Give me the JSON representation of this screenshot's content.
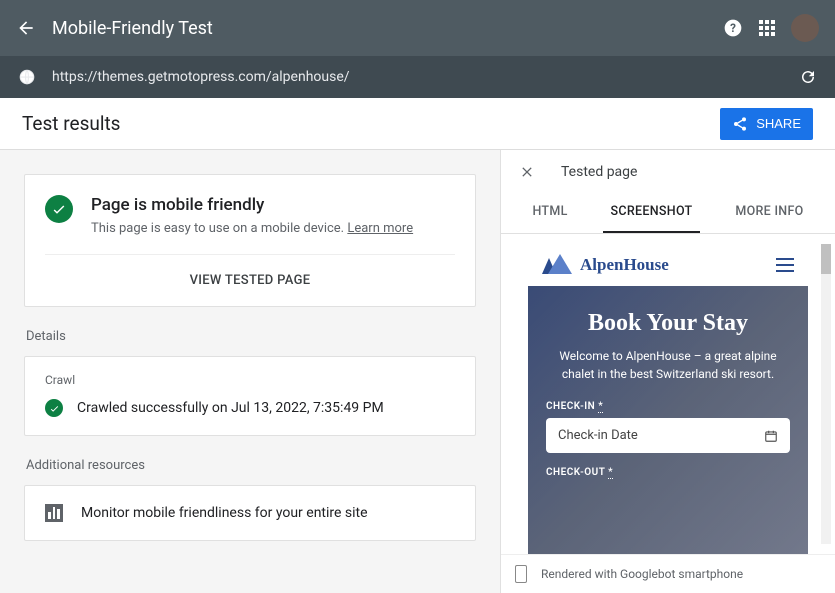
{
  "header": {
    "title": "Mobile-Friendly Test"
  },
  "urlbar": {
    "url": "https://themes.getmotopress.com/alpenhouse/"
  },
  "subheader": {
    "title": "Test results",
    "share": "SHARE"
  },
  "status": {
    "title": "Page is mobile friendly",
    "subtitle": "This page is easy to use on a mobile device.",
    "learn_more": "Learn more",
    "view_tested": "VIEW TESTED PAGE"
  },
  "sections": {
    "details": "Details",
    "additional": "Additional resources"
  },
  "crawl": {
    "label": "Crawl",
    "text": "Crawled successfully on Jul 13, 2022, 7:35:49 PM"
  },
  "resources": {
    "monitor": "Monitor mobile friendliness for your entire site"
  },
  "right_panel": {
    "title": "Tested page",
    "tabs": {
      "html": "HTML",
      "screenshot": "SCREENSHOT",
      "more": "MORE INFO"
    }
  },
  "preview": {
    "brand": "AlpenHouse",
    "hero_title": "Book Your Stay",
    "hero_sub": "Welcome to AlpenHouse – a great alpine chalet in the best Switzerland ski resort.",
    "checkin_label": "CHECK-IN",
    "checkin_placeholder": "Check-in Date",
    "checkout_label": "CHECK-OUT",
    "required_mark": "*",
    "footer": "Rendered with Googlebot smartphone"
  }
}
